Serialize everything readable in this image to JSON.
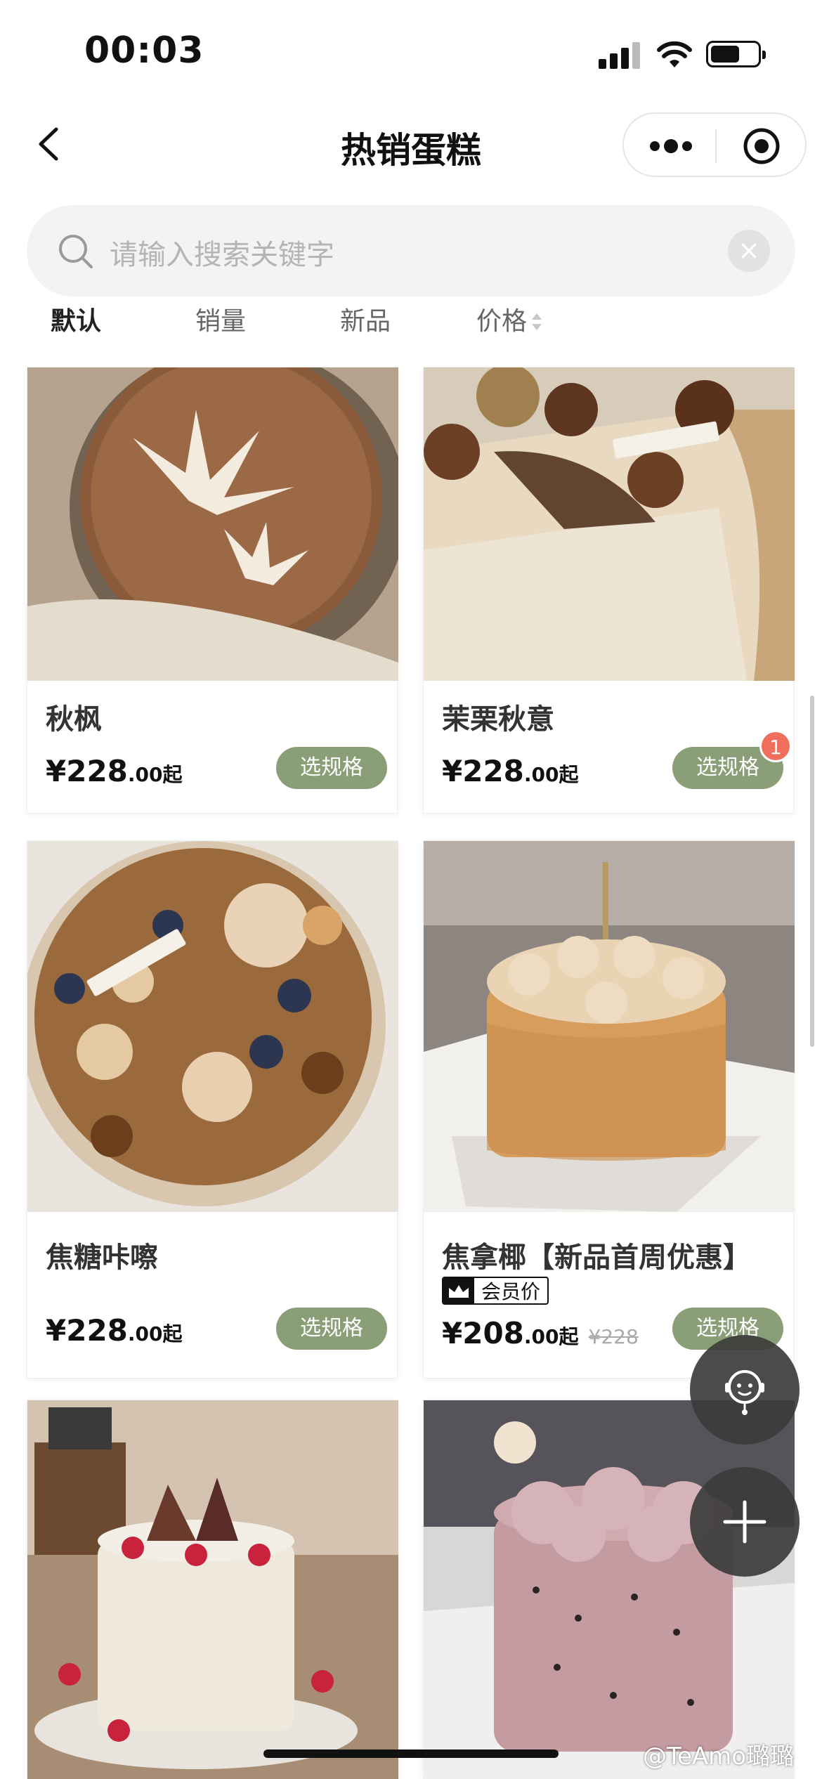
{
  "status_bar": {
    "time": "00:03"
  },
  "nav": {
    "title": "热销蛋糕"
  },
  "search": {
    "placeholder": "请输入搜索关键字",
    "clear_glyph": "×"
  },
  "sort_tabs": [
    {
      "label": "默认",
      "active": true
    },
    {
      "label": "销量",
      "active": false
    },
    {
      "label": "新品",
      "active": false
    },
    {
      "label": "价格",
      "active": false
    }
  ],
  "products": [
    {
      "name": "秋枫",
      "currency": "¥",
      "price_int": "228",
      "price_dec": ".00",
      "suffix": "起",
      "button": "选规格",
      "image": "tiramisu-maple-cake-photo"
    },
    {
      "name": "茉栗秋意",
      "currency": "¥",
      "price_int": "228",
      "price_dec": ".00",
      "suffix": "起",
      "button": "选规格",
      "cart_count": "1",
      "image": "chestnut-mont-blanc-cake-photo"
    },
    {
      "name": "焦糖咔嚓",
      "currency": "¥",
      "price_int": "228",
      "price_dec": ".00",
      "suffix": "起",
      "button": "选规格",
      "image": "caramel-nut-macaron-cake-photo"
    },
    {
      "name": "焦拿椰【新品首周优惠】",
      "member_tag": "会员价",
      "currency": "¥",
      "price_int": "208",
      "price_dec": ".00",
      "suffix": "起",
      "original_price": "¥228",
      "button": "选规格",
      "image": "almond-cream-cake-photo"
    },
    {
      "name": "",
      "image": "fig-raspberry-cake-photo"
    },
    {
      "name": "",
      "image": "pink-oreo-bear-cake-photo"
    }
  ],
  "floating": {
    "service_icon": "customer-service-icon",
    "add_icon": "plus-icon"
  },
  "watermark": "@TeAmo璐璐",
  "colors": {
    "accent_green": "#8a9f77",
    "badge_red": "#ef6f5c"
  }
}
